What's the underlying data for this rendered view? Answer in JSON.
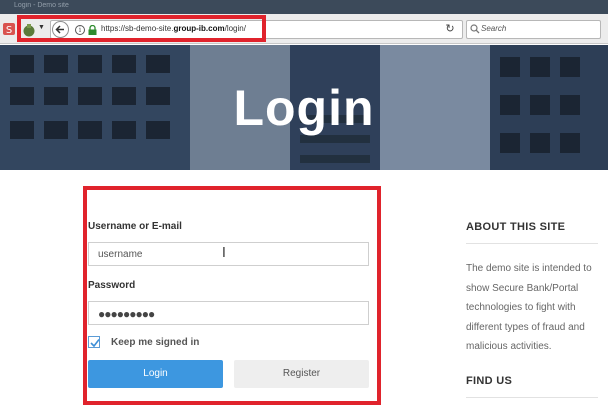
{
  "browser": {
    "tab_title": "Login - Demo site",
    "url_prefix": "https://sb-demo-site.",
    "url_domain": "group-ib.com",
    "url_suffix": "/login/",
    "search_placeholder": "Search",
    "icons": [
      "back-icon",
      "info-icon",
      "lock-icon",
      "reload-icon",
      "search-icon"
    ]
  },
  "hero": {
    "title": "Login"
  },
  "form": {
    "username_label": "Username or E-mail",
    "username_value": "username",
    "password_label": "Password",
    "password_value": "●●●●●●●●●",
    "keep_signed_in_label": "Keep me signed in",
    "keep_signed_in_checked": true,
    "login_label": "Login",
    "register_label": "Register"
  },
  "sidebar": {
    "about_heading": "ABOUT THIS SITE",
    "about_text": "The demo site is intended to show Secure Bank/Portal technologies to fight with different types of fraud and malicious activities.",
    "find_heading": "FIND US"
  },
  "colors": {
    "annotation_red": "#e0232c",
    "login_button": "#3d97e0",
    "hero_overlay": "#2a3b52"
  }
}
